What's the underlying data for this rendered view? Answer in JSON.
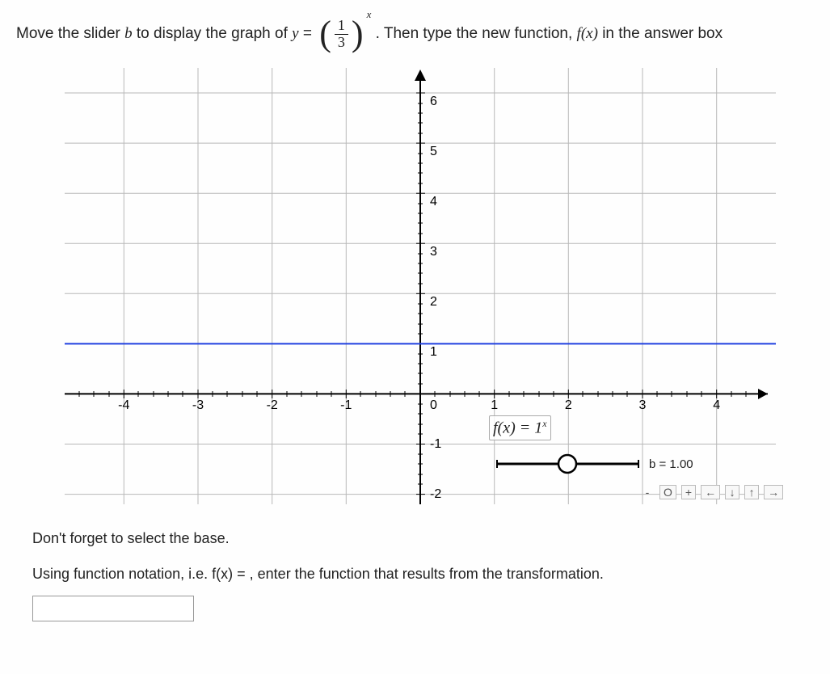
{
  "instruction": {
    "part1": "Move the slider ",
    "var_b": "b",
    "part2": " to display the graph of ",
    "var_y": "y",
    "equals": " = ",
    "frac_num": "1",
    "frac_den": "3",
    "exponent": "x",
    "part3": ". Then type the new function, ",
    "fx": "f(x)",
    "part4": " in the answer box"
  },
  "chart_data": {
    "type": "line",
    "title": "",
    "xlabel": "",
    "ylabel": "",
    "xlim": [
      -4.8,
      4.8
    ],
    "ylim": [
      -2.2,
      6.5
    ],
    "x_ticks": [
      -4,
      -3,
      -2,
      -1,
      0,
      1,
      2,
      3,
      4
    ],
    "y_ticks": [
      -2,
      -1,
      0,
      1,
      2,
      3,
      4,
      5,
      6
    ],
    "series": [
      {
        "name": "f(x) = 1^x",
        "color": "#2040e0",
        "x": [
          -4.8,
          4.8
        ],
        "y": [
          1,
          1
        ]
      }
    ],
    "function_label": "f(x) = 1",
    "function_label_exp": "x",
    "slider": {
      "name": "b",
      "value": 1.0,
      "label": "b = 1.00"
    },
    "toolbar": {
      "reset": "O",
      "zoom_in": "+",
      "left": "←",
      "down": "↓",
      "up": "↑",
      "right": "→"
    }
  },
  "footer": {
    "line1": "Don't forget to select the base.",
    "line2_a": "Using function notation, i.e. ",
    "line2_fx": "f(x) = ",
    "line2_b": ", enter the function that results from the transformation."
  }
}
